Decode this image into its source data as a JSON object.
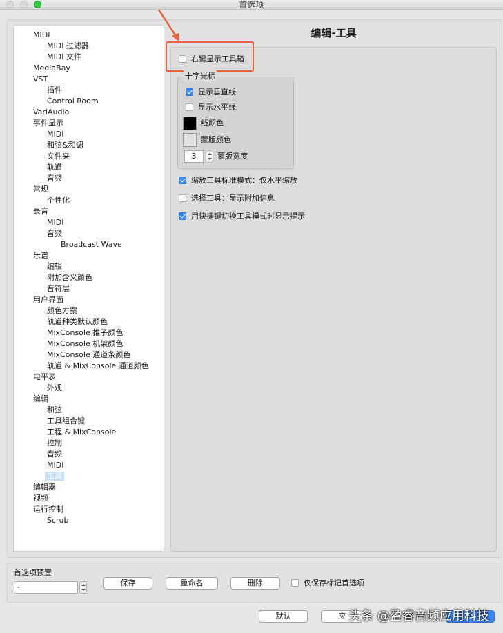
{
  "window": {
    "title": "首选项"
  },
  "tree": {
    "items": [
      {
        "label": "MIDI",
        "level": 0
      },
      {
        "label": "MIDI 过滤器",
        "level": 1
      },
      {
        "label": "MIDI 文件",
        "level": 1
      },
      {
        "label": "MediaBay",
        "level": 0
      },
      {
        "label": "VST",
        "level": 0
      },
      {
        "label": "插件",
        "level": 1
      },
      {
        "label": "Control Room",
        "level": 1
      },
      {
        "label": "VariAudio",
        "level": 0
      },
      {
        "label": "事件显示",
        "level": 0
      },
      {
        "label": "MIDI",
        "level": 1
      },
      {
        "label": "和弦&和调",
        "level": 1
      },
      {
        "label": "文件夹",
        "level": 1
      },
      {
        "label": "轨道",
        "level": 1
      },
      {
        "label": "音频",
        "level": 1
      },
      {
        "label": "常规",
        "level": 0
      },
      {
        "label": "个性化",
        "level": 1
      },
      {
        "label": "录音",
        "level": 0
      },
      {
        "label": "MIDI",
        "level": 1
      },
      {
        "label": "音频",
        "level": 1
      },
      {
        "label": "Broadcast Wave",
        "level": 2
      },
      {
        "label": "乐谱",
        "level": 0
      },
      {
        "label": "编辑",
        "level": 1
      },
      {
        "label": "附加含义颜色",
        "level": 1
      },
      {
        "label": "音符层",
        "level": 1
      },
      {
        "label": "用户界面",
        "level": 0
      },
      {
        "label": "颜色方案",
        "level": 1
      },
      {
        "label": "轨道种类默认颜色",
        "level": 1
      },
      {
        "label": "MixConsole 推子颜色",
        "level": 1
      },
      {
        "label": "MixConsole 机架颜色",
        "level": 1
      },
      {
        "label": "MixConsole 通道条颜色",
        "level": 1
      },
      {
        "label": "轨道 & MixConsole 通道颜色",
        "level": 1
      },
      {
        "label": "电平表",
        "level": 0
      },
      {
        "label": "外观",
        "level": 1
      },
      {
        "label": "编辑",
        "level": 0
      },
      {
        "label": "和弦",
        "level": 1
      },
      {
        "label": "工具组合键",
        "level": 1
      },
      {
        "label": "工程 & MixConsole",
        "level": 1
      },
      {
        "label": "控制",
        "level": 1
      },
      {
        "label": "音频",
        "level": 1
      },
      {
        "label": "MIDI",
        "level": 1
      },
      {
        "label": "工具",
        "level": 1,
        "selected": true
      },
      {
        "label": "编辑器",
        "level": 0
      },
      {
        "label": "视频",
        "level": 0
      },
      {
        "label": "运行控制",
        "level": 0
      },
      {
        "label": "Scrub",
        "level": 1
      }
    ]
  },
  "panel": {
    "title": "编辑-工具",
    "right_click_toolbox": {
      "label": "右键显示工具箱",
      "checked": false
    },
    "crosshair": {
      "title": "十字光标",
      "show_vertical": {
        "label": "显示垂直线",
        "checked": true
      },
      "show_horizontal": {
        "label": "显示水平线",
        "checked": false
      },
      "line_color": {
        "label": "线颜色",
        "color": "#000000"
      },
      "mask_color": {
        "label": "蒙版颜色",
        "color": "#e0e0e0"
      },
      "mask_width": {
        "label": "蒙版宽度",
        "value": "3"
      }
    },
    "zoom_standard": {
      "label": "缩放工具标准模式：仅水平缩放",
      "checked": true
    },
    "select_tool_info": {
      "label": "选择工具：显示附加信息",
      "checked": false
    },
    "shortcut_tooltip": {
      "label": "用快捷键切换工具模式时显示提示",
      "checked": true
    }
  },
  "presets": {
    "label": "首选项预置",
    "value": "-",
    "save_label": "保存",
    "rename_label": "重命名",
    "delete_label": "删除",
    "marked_only": {
      "label": "仅保存标记首选项",
      "checked": false
    }
  },
  "footer": {
    "default_label": "默认",
    "apply_label": "应"
  },
  "watermark": "头条 @盈睿音频应用科技",
  "colors": {
    "accent": "#3d89f5",
    "highlight_annotation": "#e8623a",
    "selection": "#c5dcf6"
  }
}
